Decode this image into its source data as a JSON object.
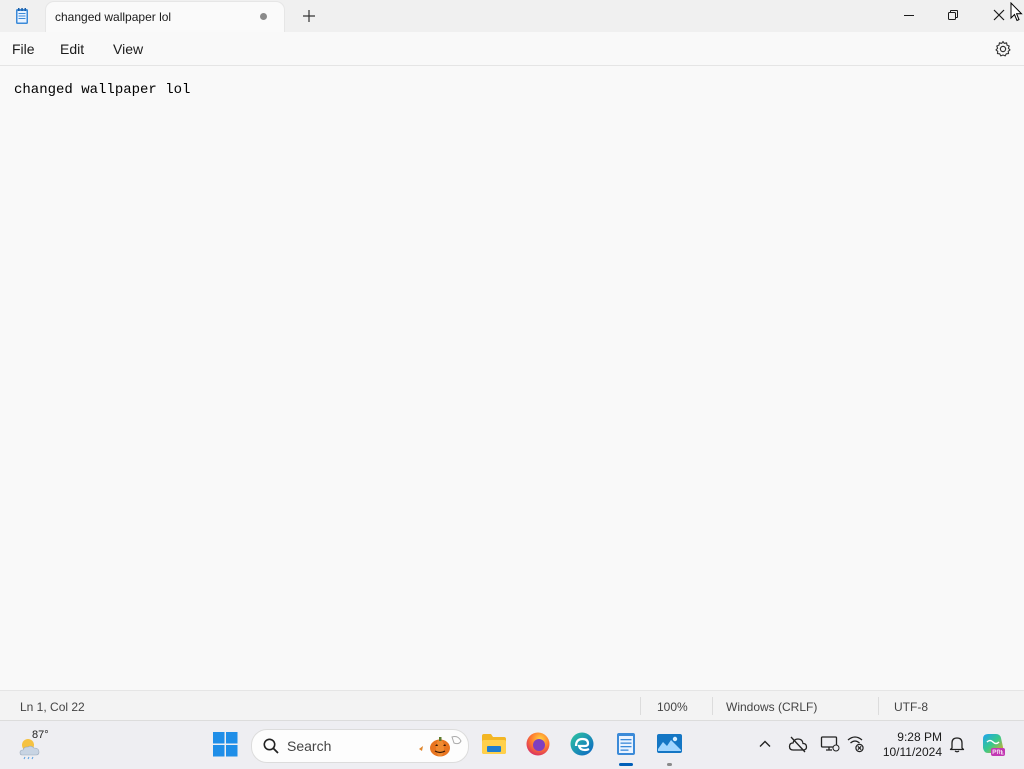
{
  "window": {
    "tab_title": "changed wallpaper lol",
    "new_tab_symbol": "+",
    "icons": [
      "notepad-icon",
      "minimize-icon",
      "restore-icon",
      "close-icon"
    ]
  },
  "menu": {
    "file": "File",
    "edit": "Edit",
    "view": "View"
  },
  "editor": {
    "content": "changed wallpaper lol"
  },
  "status": {
    "position": "Ln 1, Col 22",
    "zoom": "100%",
    "line_ending": "Windows (CRLF)",
    "encoding": "UTF-8"
  },
  "taskbar": {
    "weather_temp": "87°",
    "search_placeholder": "Search",
    "time": "9:28 PM",
    "date": "10/11/2024",
    "pinned_apps": [
      "windows-start-icon",
      "file-explorer-icon",
      "firefox-icon",
      "edge-icon",
      "notepad-icon",
      "photos-icon"
    ],
    "tray_icons": [
      "chevron-up-icon",
      "cloud-offline-icon",
      "display-icon",
      "network-icon",
      "notification-bell-icon",
      "copilot-icon"
    ]
  },
  "colors": {
    "accent": "#005fb8",
    "window_bg": "#f9f9f9",
    "titlebar_bg": "#f0f0f0"
  }
}
